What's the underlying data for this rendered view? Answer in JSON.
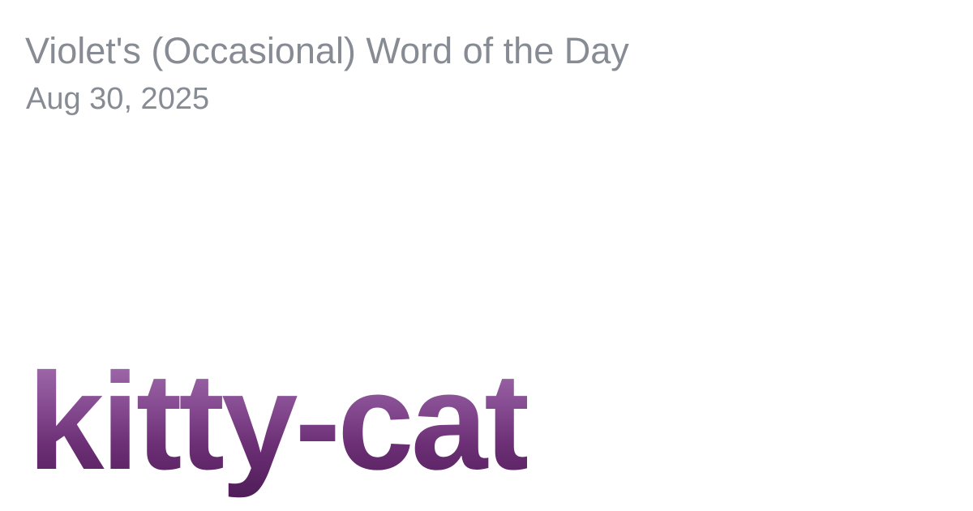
{
  "header": {
    "site_title": "Violet's (Occasional) Word of the Day",
    "date": "Aug 30, 2025"
  },
  "main": {
    "word": "kitty-cat"
  },
  "colors": {
    "muted_text": "#878b93",
    "word_gradient_top": "#a876b6",
    "word_gradient_bottom": "#4f1c58",
    "background": "#ffffff"
  }
}
